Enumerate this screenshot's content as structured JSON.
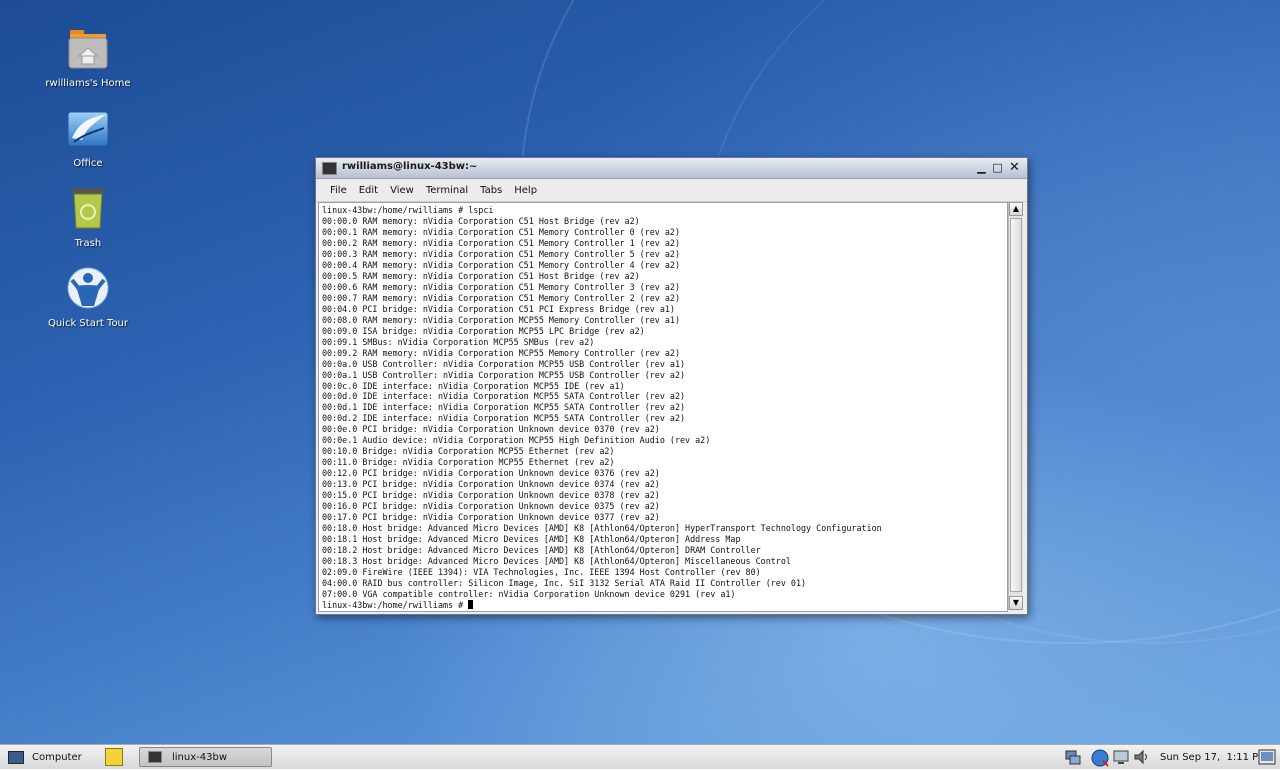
{
  "desktop": {
    "icons": [
      {
        "label": "rwilliams's Home",
        "icon": "home-folder-icon"
      },
      {
        "label": "Office",
        "icon": "office-gull-icon"
      },
      {
        "label": "Trash",
        "icon": "trash-icon"
      },
      {
        "label": "Quick Start Tour",
        "icon": "quick-start-icon"
      }
    ]
  },
  "window": {
    "title": "rwilliams@linux-43bw:~",
    "menu": [
      "File",
      "Edit",
      "View",
      "Terminal",
      "Tabs",
      "Help"
    ],
    "lines": [
      "linux-43bw:/home/rwilliams # lspci",
      "00:00.0 RAM memory: nVidia Corporation C51 Host Bridge (rev a2)",
      "00:00.1 RAM memory: nVidia Corporation C51 Memory Controller 0 (rev a2)",
      "00:00.2 RAM memory: nVidia Corporation C51 Memory Controller 1 (rev a2)",
      "00:00.3 RAM memory: nVidia Corporation C51 Memory Controller 5 (rev a2)",
      "00:00.4 RAM memory: nVidia Corporation C51 Memory Controller 4 (rev a2)",
      "00:00.5 RAM memory: nVidia Corporation C51 Host Bridge (rev a2)",
      "00:00.6 RAM memory: nVidia Corporation C51 Memory Controller 3 (rev a2)",
      "00:00.7 RAM memory: nVidia Corporation C51 Memory Controller 2 (rev a2)",
      "00:04.0 PCI bridge: nVidia Corporation C51 PCI Express Bridge (rev a1)",
      "00:08.0 RAM memory: nVidia Corporation MCP55 Memory Controller (rev a1)",
      "00:09.0 ISA bridge: nVidia Corporation MCP55 LPC Bridge (rev a2)",
      "00:09.1 SMBus: nVidia Corporation MCP55 SMBus (rev a2)",
      "00:09.2 RAM memory: nVidia Corporation MCP55 Memory Controller (rev a2)",
      "00:0a.0 USB Controller: nVidia Corporation MCP55 USB Controller (rev a1)",
      "00:0a.1 USB Controller: nVidia Corporation MCP55 USB Controller (rev a2)",
      "00:0c.0 IDE interface: nVidia Corporation MCP55 IDE (rev a1)",
      "00:0d.0 IDE interface: nVidia Corporation MCP55 SATA Controller (rev a2)",
      "00:0d.1 IDE interface: nVidia Corporation MCP55 SATA Controller (rev a2)",
      "00:0d.2 IDE interface: nVidia Corporation MCP55 SATA Controller (rev a2)",
      "00:0e.0 PCI bridge: nVidia Corporation Unknown device 0370 (rev a2)",
      "00:0e.1 Audio device: nVidia Corporation MCP55 High Definition Audio (rev a2)",
      "00:10.0 Bridge: nVidia Corporation MCP55 Ethernet (rev a2)",
      "00:11.0 Bridge: nVidia Corporation MCP55 Ethernet (rev a2)",
      "00:12.0 PCI bridge: nVidia Corporation Unknown device 0376 (rev a2)",
      "00:13.0 PCI bridge: nVidia Corporation Unknown device 0374 (rev a2)",
      "00:15.0 PCI bridge: nVidia Corporation Unknown device 0378 (rev a2)",
      "00:16.0 PCI bridge: nVidia Corporation Unknown device 0375 (rev a2)",
      "00:17.0 PCI bridge: nVidia Corporation Unknown device 0377 (rev a2)",
      "00:18.0 Host bridge: Advanced Micro Devices [AMD] K8 [Athlon64/Opteron] HyperTransport Technology Configuration",
      "00:18.1 Host bridge: Advanced Micro Devices [AMD] K8 [Athlon64/Opteron] Address Map",
      "00:18.2 Host bridge: Advanced Micro Devices [AMD] K8 [Athlon64/Opteron] DRAM Controller",
      "00:18.3 Host bridge: Advanced Micro Devices [AMD] K8 [Athlon64/Opteron] Miscellaneous Control",
      "02:09.0 FireWire (IEEE 1394): VIA Technologies, Inc. IEEE 1394 Host Controller (rev 80)",
      "04:00.0 RAID bus controller: Silicon Image, Inc. SiI 3132 Serial ATA Raid II Controller (rev 01)",
      "07:00.0 VGA compatible controller: nVidia Corporation Unknown device 0291 (rev a1)"
    ],
    "prompt": "linux-43bw:/home/rwilliams # "
  },
  "panel": {
    "computer_label": "Computer",
    "task_label": "linux-43bw",
    "clock": "Sun Sep 17,  1:11 PM"
  }
}
